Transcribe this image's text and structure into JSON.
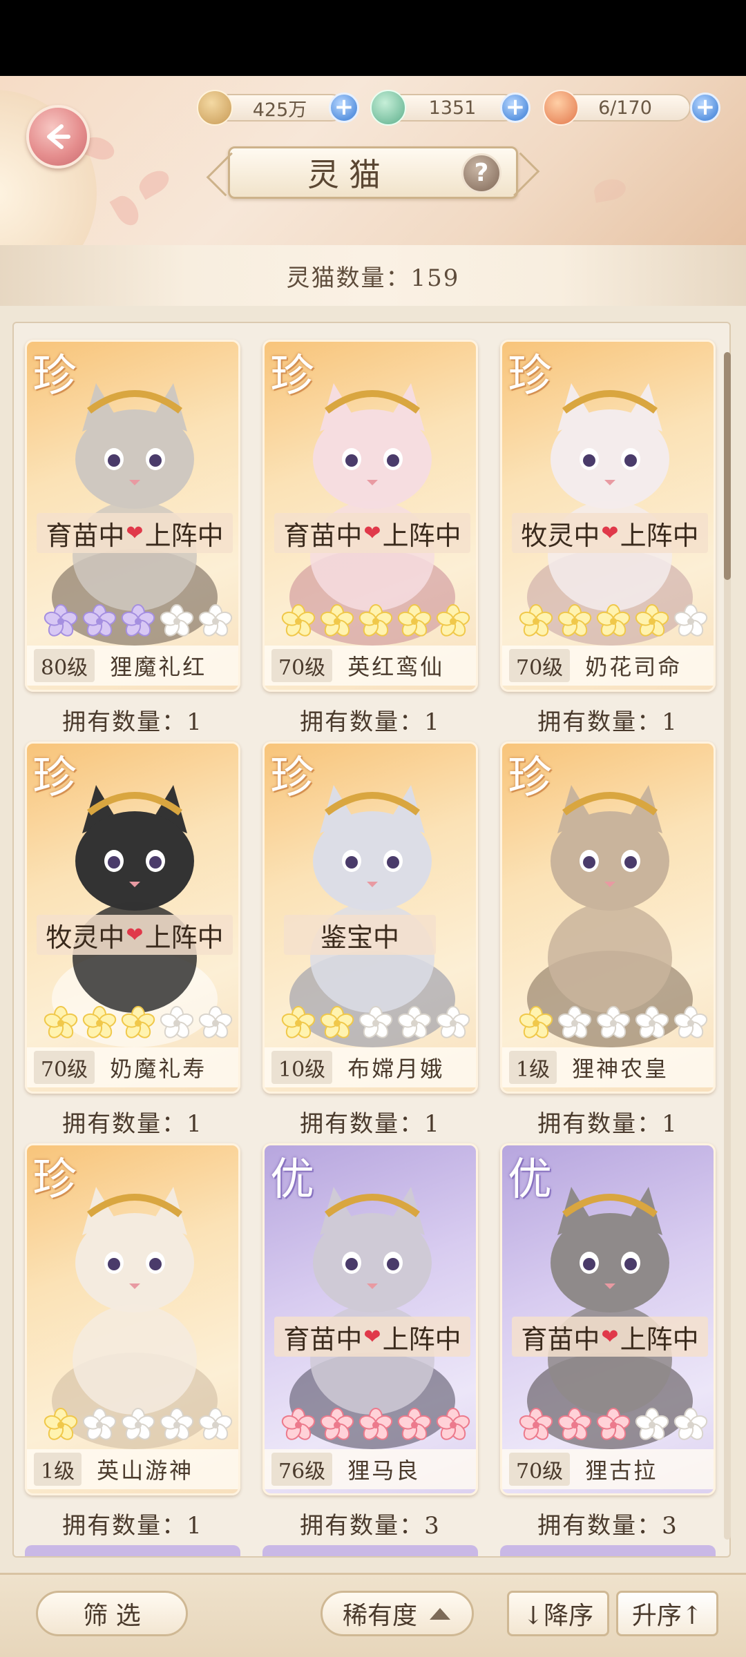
{
  "header": {
    "title": "灵猫",
    "help_label": "?",
    "resources": [
      {
        "icon": "paw-coin-icon",
        "value": "425万"
      },
      {
        "icon": "jade-frog-icon",
        "value": "1351"
      },
      {
        "icon": "food-bowl-icon",
        "value": "6/170"
      }
    ],
    "cat_count_label": "灵猫数量：159"
  },
  "cards": [
    {
      "rarity": "珍",
      "theme": "gold",
      "status": "育苗中",
      "status2": "上阵中",
      "stars": 5,
      "star_color": "purple",
      "filled": 3,
      "level": "80级",
      "name": "狸魔礼红",
      "own": "拥有数量：1"
    },
    {
      "rarity": "珍",
      "theme": "gold",
      "status": "育苗中",
      "status2": "上阵中",
      "stars": 5,
      "star_color": "yellow",
      "filled": 5,
      "level": "70级",
      "name": "英红鸾仙",
      "own": "拥有数量：1"
    },
    {
      "rarity": "珍",
      "theme": "gold",
      "status": "牧灵中",
      "status2": "上阵中",
      "stars": 5,
      "star_color": "yellow",
      "filled": 4,
      "level": "70级",
      "name": "奶花司命",
      "own": "拥有数量：1"
    },
    {
      "rarity": "珍",
      "theme": "gold",
      "status": "牧灵中",
      "status2": "上阵中",
      "stars": 5,
      "star_color": "yellow",
      "filled": 3,
      "level": "70级",
      "name": "奶魔礼寿",
      "own": "拥有数量：1"
    },
    {
      "rarity": "珍",
      "theme": "gold",
      "status": "鉴宝中",
      "status2": "",
      "stars": 5,
      "star_color": "yellow",
      "filled": 2,
      "level": "10级",
      "name": "布嫦月娥",
      "own": "拥有数量：1"
    },
    {
      "rarity": "珍",
      "theme": "gold",
      "status": "",
      "status2": "",
      "stars": 5,
      "star_color": "yellow",
      "filled": 1,
      "level": "1级",
      "name": "狸神农皇",
      "own": "拥有数量：1"
    },
    {
      "rarity": "珍",
      "theme": "gold",
      "status": "",
      "status2": "",
      "stars": 5,
      "star_color": "yellow",
      "filled": 1,
      "level": "1级",
      "name": "英山游神",
      "own": "拥有数量：1"
    },
    {
      "rarity": "优",
      "theme": "purple",
      "status": "育苗中",
      "status2": "上阵中",
      "stars": 5,
      "star_color": "pink",
      "filled": 5,
      "level": "76级",
      "name": "狸马良",
      "own": "拥有数量：3"
    },
    {
      "rarity": "优",
      "theme": "purple",
      "status": "育苗中",
      "status2": "上阵中",
      "stars": 5,
      "star_color": "pink",
      "filled": 3,
      "level": "70级",
      "name": "狸古拉",
      "own": "拥有数量：3"
    }
  ],
  "footer": {
    "filter_label": "筛 选",
    "rarity_label": "稀有度",
    "desc_label": "↓降序",
    "asc_label": "升序↑"
  },
  "colors": {
    "gold_card": "#f8c47a",
    "purple_card": "#b7a6de",
    "heart": "#e0394a",
    "plus_button": "#5c95e0"
  }
}
